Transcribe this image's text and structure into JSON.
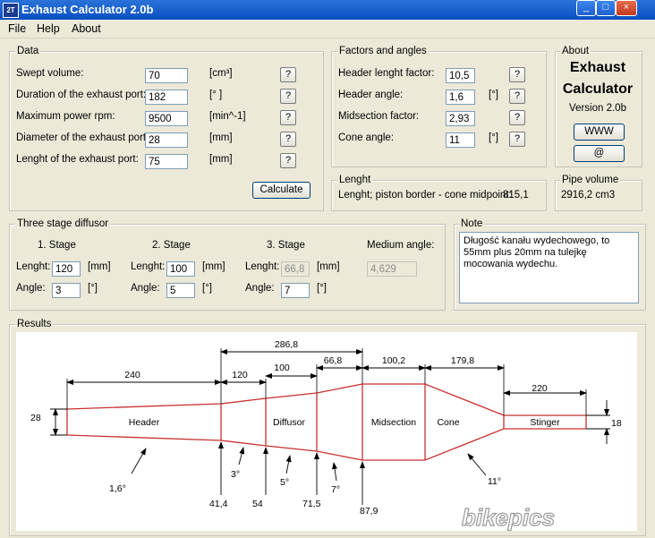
{
  "window": {
    "title": "Exhaust Calculator 2.0b",
    "icon_text": "2T",
    "min": "_",
    "max": "□",
    "close": "×"
  },
  "menu": {
    "file": "File",
    "help": "Help",
    "about": "About"
  },
  "data_group": {
    "title": "Data",
    "rows": [
      {
        "label": "Swept volume:",
        "value": "70",
        "unit": "[cm³]"
      },
      {
        "label": "Duration of the exhaust port:",
        "value": "182",
        "unit": "[° ]"
      },
      {
        "label": "Maximum power rpm:",
        "value": "9500",
        "unit": "[min^-1]"
      },
      {
        "label": "Diameter of the exhaust port:",
        "value": "28",
        "unit": "[mm]"
      },
      {
        "label": "Lenght of the exhaust port:",
        "value": "75",
        "unit": "[mm]"
      }
    ],
    "help": "?",
    "calculate": "Calculate"
  },
  "factors_group": {
    "title": "Factors and angles",
    "rows": [
      {
        "label": "Header lenght factor:",
        "value": "10,5",
        "unit": ""
      },
      {
        "label": "Header angle:",
        "value": "1,6",
        "unit": "[°]"
      },
      {
        "label": "Midsection factor:",
        "value": "2,93",
        "unit": ""
      },
      {
        "label": "Cone angle:",
        "value": "11",
        "unit": "[°]"
      }
    ]
  },
  "about_group": {
    "title": "About",
    "name1": "Exhaust",
    "name2": "Calculator",
    "version": "Version 2.0b",
    "www": "WWW",
    "mail": "@"
  },
  "lenght_group": {
    "title": "Lenght",
    "text": "Lenght; piston border - cone midpoint:",
    "value": "815,1"
  },
  "pipe_group": {
    "title": "Pipe volume",
    "value": "2916,2 cm3"
  },
  "diffusor_group": {
    "title": "Three stage diffusor",
    "stages": [
      {
        "title": "1. Stage",
        "length_label": "Lenght:",
        "length": "120",
        "unit": "[mm]",
        "angle_label": "Angle:",
        "angle": "3",
        "angle_unit": "[°]"
      },
      {
        "title": "2. Stage",
        "length_label": "Lenght:",
        "length": "100",
        "unit": "[mm]",
        "angle_label": "Angle:",
        "angle": "5",
        "angle_unit": "[°]"
      },
      {
        "title": "3. Stage",
        "length_label": "Lenght:",
        "length": "66,8",
        "unit": "[mm]",
        "angle_label": "Angle:",
        "angle": "7",
        "angle_unit": "[°]"
      }
    ],
    "medium_title": "Medium angle:",
    "medium_value": "4,629"
  },
  "note_group": {
    "title": "Note",
    "text": "Długość kanału wydechowego, to 55mm plus 20mm na tulejkę mocowania wydechu."
  },
  "results_group": {
    "title": "Results"
  },
  "diagram": {
    "sections": {
      "header": "Header",
      "diffusor": "Diffusor",
      "midsection": "Midsection",
      "cone": "Cone",
      "stinger": "Stinger"
    },
    "dims": {
      "header_len": "240",
      "stage1_len": "120",
      "stage2_len": "100",
      "stage3_len": "66,8",
      "diffusor_total": "286,8",
      "mid_len": "100,2",
      "cone_len": "179,8",
      "stinger_len": "220"
    },
    "diam_in": "28",
    "diam_out": "18",
    "angles": {
      "header": "1,6°",
      "s1": "3°",
      "s2": "5°",
      "s3": "7°",
      "cone": "11°"
    },
    "diameters": {
      "d1": "41,4",
      "d2": "54",
      "d3": "71,5",
      "d4": "87,9"
    },
    "watermark": "bikepics"
  },
  "colors": {
    "pipe": "#c83030",
    "dim": "#000000",
    "title_bar": "#0a4fc4"
  }
}
